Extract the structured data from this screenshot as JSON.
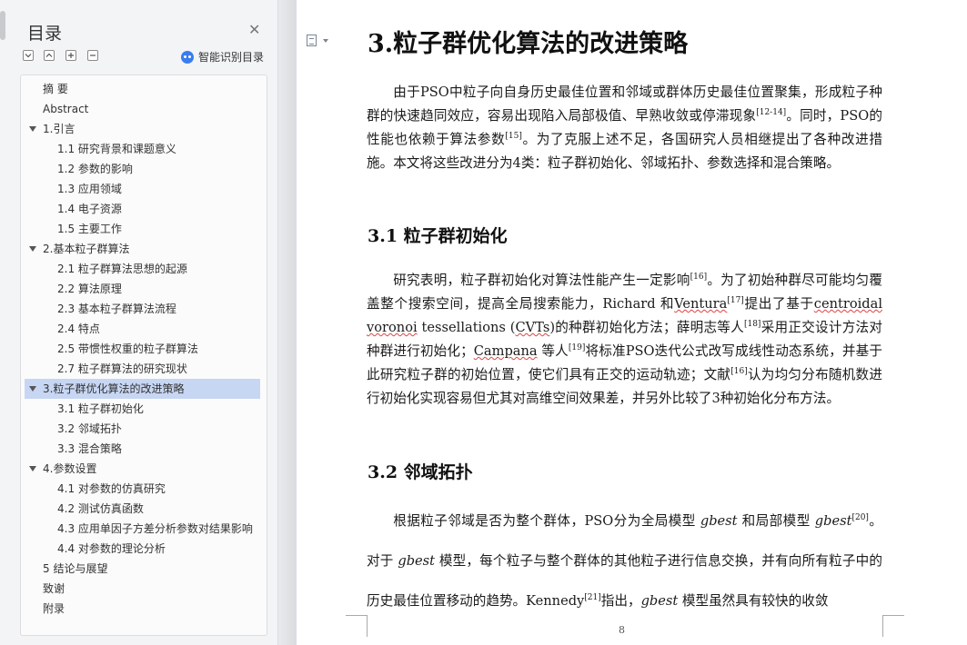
{
  "nav": {
    "title": "目录",
    "smart_toc_label": "智能识别目录",
    "items": [
      {
        "label": "摘  要",
        "level": 0
      },
      {
        "label": "Abstract",
        "level": 0
      },
      {
        "label": "1.引言",
        "level": 1
      },
      {
        "label": "1.1  研究背景和课题意义",
        "level": 2
      },
      {
        "label": "1.2  参数的影响",
        "level": 2
      },
      {
        "label": "1.3  应用领域",
        "level": 2
      },
      {
        "label": "1.4  电子资源",
        "level": 2
      },
      {
        "label": "1.5  主要工作",
        "level": 2
      },
      {
        "label": "2.基本粒子群算法",
        "level": 1
      },
      {
        "label": "2.1  粒子群算法思想的起源",
        "level": 2
      },
      {
        "label": "2.2  算法原理",
        "level": 2
      },
      {
        "label": "2.3  基本粒子群算法流程",
        "level": 2
      },
      {
        "label": "2.4  特点",
        "level": 2
      },
      {
        "label": "2.5  带惯性权重的粒子群算法",
        "level": 2
      },
      {
        "label": "2.7  粒子群算法的研究现状",
        "level": 2
      },
      {
        "label": "3.粒子群优化算法的改进策略",
        "level": 1,
        "active": true
      },
      {
        "label": "3.1  粒子群初始化",
        "level": 2
      },
      {
        "label": "3.2  邻域拓扑",
        "level": 2
      },
      {
        "label": "3.3  混合策略",
        "level": 2
      },
      {
        "label": "4.参数设置",
        "level": 1
      },
      {
        "label": "4.1  对参数的仿真研究",
        "level": 2
      },
      {
        "label": "4.2  测试仿真函数",
        "level": 2
      },
      {
        "label": "4.3  应用单因子方差分析参数对结果影响",
        "level": 2
      },
      {
        "label": "4.4  对参数的理论分析",
        "level": 2
      },
      {
        "label": "5 结论与展望",
        "level": 0
      },
      {
        "label": "致谢",
        "level": 0
      },
      {
        "label": "附录",
        "level": 0
      }
    ]
  },
  "doc": {
    "heading": "3.粒子群优化算法的改进策略",
    "p1": {
      "a": "由于PSO中粒子向自身历史最佳位置和邻域或群体历史最佳位置聚集，形成粒子种群的快速趋同效应，容易出现陷入局部极值、早熟收敛或停滞现象",
      "ref1": "[12-14]",
      "b": "。同时，PSO的性能也依赖于算法参数",
      "ref2": "[15]",
      "c": "。为了克服上述不足，各国研究人员相继提出了各种改进措施。本文将这些改进分为4类：粒子群初始化、邻域拓扑、参数选择和混合策略。"
    },
    "s31": "3.1  粒子群初始化",
    "p2": {
      "a": "研究表明，粒子群初始化对算法性能产生一定影响",
      "ref1": "[16]",
      "b": "。为了初始种群尽可能均匀覆盖整个搜索空间，提高全局搜索能力，Richard 和",
      "ventura": "Ventura",
      "ref2": "[17]",
      "c": "提出了基于",
      "centroidal": "centroidal voronoi",
      "d": " tessellations (",
      "cvts": "CVTs",
      "e": ")的种群初始化方法；薛明志等人",
      "ref3": "[18]",
      "f": "采用正交设计方法对种群进行初始化；",
      "campana": "Campana",
      "g": " 等人",
      "ref4": "[19]",
      "h": "将标准PSO迭代公式改写成线性动态系统，并基于此研究粒子群的初始位置，使它们具有正交的运动轨迹；文献",
      "ref5": "[16]",
      "i": "认为均匀分布随机数进行初始化实现容易但尤其对高维空间效果差，并另外比较了3种初始化分布方法。"
    },
    "s32": "3.2  邻域拓扑",
    "p3": {
      "a": "根据粒子邻域是否为整个群体，PSO分为全局模型 ",
      "g1": "gbest",
      "b": " 和局部模型 ",
      "g2": "gbest",
      "ref1": "[20]",
      "c": "。对于 ",
      "g3": "gbest",
      "d": " 模型，每个粒子与整个群体的其他粒子进行信息交换，并有向所有粒子中的历史最佳位置移动的趋势。Kennedy",
      "ref2": "[21]",
      "e": "指出，",
      "g4": "gbest",
      "f": " 模型虽然具有较快的收敛"
    },
    "page_number": "8"
  }
}
